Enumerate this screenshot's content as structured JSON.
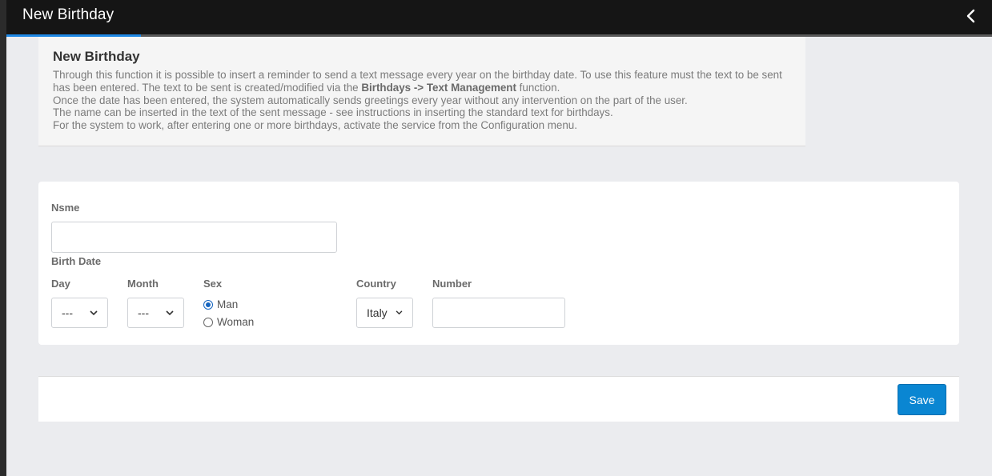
{
  "header": {
    "title": "New Birthday",
    "back_icon": "chevron-left-icon"
  },
  "info": {
    "title": "New Birthday",
    "line1_pre": "Through this function it is possible to insert a reminder to send a text message every year on the birthday date. To use this feature must the text to be sent has been entered. The text to be sent is created/modified via the ",
    "line1_bold": "Birthdays -> Text Management",
    "line1_post": " function.",
    "line2": "Once the date has been entered, the system automatically sends greetings every year without any intervention on the part of the user.",
    "line3": "The name can be inserted in the text of the sent message - see instructions in inserting the standard text for birthdays.",
    "line4": "For the system to work, after entering one or more birthdays, activate the service from the Configuration menu."
  },
  "form": {
    "name_label": "Nsme",
    "name_value": "",
    "birth_date_label": "Birth Date",
    "day_label": "Day",
    "day_value": "---",
    "month_label": "Month",
    "month_value": "---",
    "sex_label": "Sex",
    "sex_options": [
      "Man",
      "Woman"
    ],
    "sex_selected": "Man",
    "country_label": "Country",
    "country_value": "Italy",
    "number_label": "Number",
    "number_value": ""
  },
  "footer": {
    "save_label": "Save"
  },
  "colors": {
    "accent": "#1e88e5",
    "save_button": "#0a86d2",
    "topbar": "#151515"
  }
}
